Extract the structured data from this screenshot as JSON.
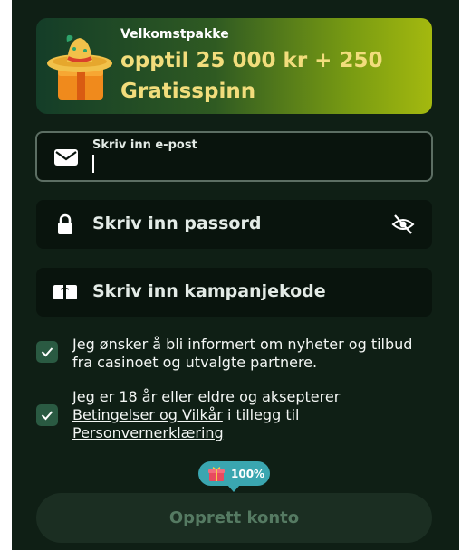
{
  "promo": {
    "kicker": "Velkomstpakke",
    "title": "opptil 25 000 kr + 250 Gratisspinn"
  },
  "form": {
    "email_label": "Skriv inn e-post",
    "password_placeholder": "Skriv inn passord",
    "promo_code_placeholder": "Skriv inn kampanjekode"
  },
  "consents": {
    "newsletter_text": "Jeg ønsker å bli informert om nyheter og tilbud fra casinoet og utvalgte partnere.",
    "terms_prefix": "Jeg er 18 år eller eldre og aksepterer",
    "terms_link": "Betingelser og Vilkår",
    "terms_middle": " i tillegg til",
    "privacy_link": "Personvernerklæring"
  },
  "progress_badge": {
    "label": "100%",
    "value": 100
  },
  "submit_label": "Opprett konto",
  "colors": {
    "accent": "#f2dd7c",
    "check": "#2a5a42",
    "badge": "#3aa6b0"
  }
}
